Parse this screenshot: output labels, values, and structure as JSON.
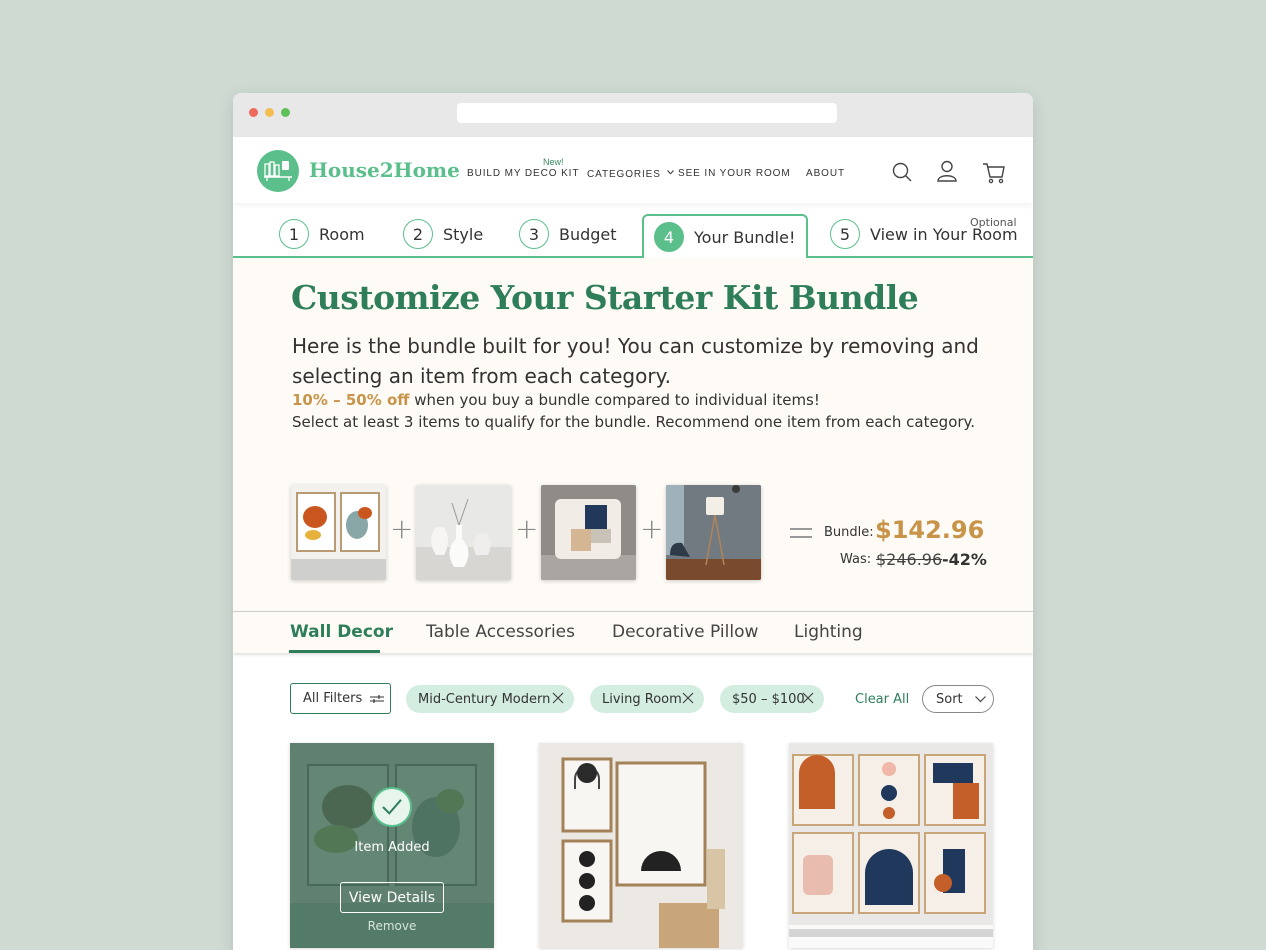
{
  "brand": {
    "name": "House2Home",
    "accent": "#5bbf8c",
    "dark_accent": "#2e7e5a",
    "gold": "#c8944a"
  },
  "nav": {
    "new_badge": "New!",
    "items": [
      "BUILD MY DECO KIT",
      "CATEGORIES",
      "SEE IN YOUR ROOM",
      "ABOUT"
    ],
    "icons": [
      "search-icon",
      "user-icon",
      "cart-icon"
    ]
  },
  "steps": [
    {
      "num": "1",
      "label": "Room"
    },
    {
      "num": "2",
      "label": "Style"
    },
    {
      "num": "3",
      "label": "Budget"
    },
    {
      "num": "4",
      "label": "Your Bundle!"
    },
    {
      "num": "5",
      "label": "View in Your Room"
    }
  ],
  "steps_optional": "Optional",
  "hero": {
    "title": "Customize Your Starter Kit Bundle",
    "subtitle": "Here is the bundle built for you! You can customize by removing and selecting an item from each category.",
    "promo_highlight": "10% – 50% off",
    "promo_rest": " when you buy a bundle compared to individual items!",
    "note": "Select at least 3 items to qualify for the bundle.  Recommend one item from each category."
  },
  "bundle": {
    "label": "Bundle:",
    "price": "$142.96",
    "was_label": "Was:",
    "was_price": "$246.96",
    "discount": "-42%"
  },
  "categories": [
    "Wall Decor",
    "Table Accessories",
    "Decorative Pillow",
    "Lighting"
  ],
  "filters": {
    "all_filters": "All Filters",
    "chips": [
      "Mid-Century Modern",
      "Living Room",
      "$50 – $100"
    ],
    "clear_all": "Clear All",
    "sort": "Sort"
  },
  "product_card": {
    "added": "Item Added",
    "view_details": "View Details",
    "remove": "Remove"
  }
}
